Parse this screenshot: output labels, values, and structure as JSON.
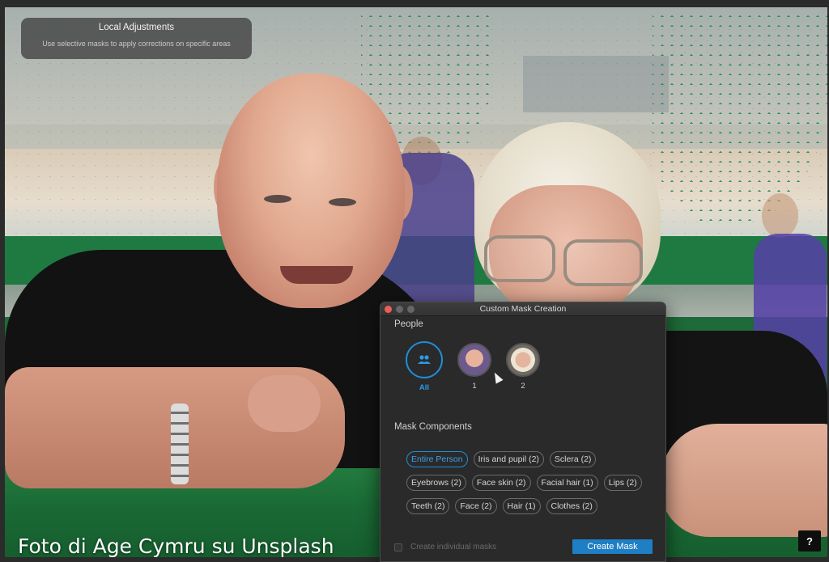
{
  "tooltip": {
    "title": "Local Adjustments",
    "subtitle": "Use selective masks to apply corrections on specific areas"
  },
  "photo": {
    "watermark": "Foto di Age Cymru su Unsplash"
  },
  "help_button": {
    "label": "?"
  },
  "dialog": {
    "title": "Custom Mask Creation",
    "people_heading": "People",
    "people": [
      {
        "label": "All",
        "icon": "people-group-icon",
        "selected": true
      },
      {
        "label": "1",
        "icon": "face-thumbnail-man"
      },
      {
        "label": "2",
        "icon": "face-thumbnail-woman"
      }
    ],
    "components_heading": "Mask Components",
    "components": [
      [
        "Entire Person",
        "Iris and pupil (2)",
        "Sclera (2)"
      ],
      [
        "Eyebrows (2)",
        "Face skin (2)",
        "Facial hair (1)",
        "Lips (2)"
      ],
      [
        "Teeth (2)",
        "Face (2)",
        "Hair (1)",
        "Clothes (2)"
      ]
    ],
    "selected_component": "Entire Person",
    "individual_masks_label": "Create individual masks",
    "create_button": "Create Mask"
  },
  "colors": {
    "accent": "#1e8fd6",
    "close": "#ec5f57",
    "dialog_bg": "#2a2a2a"
  }
}
